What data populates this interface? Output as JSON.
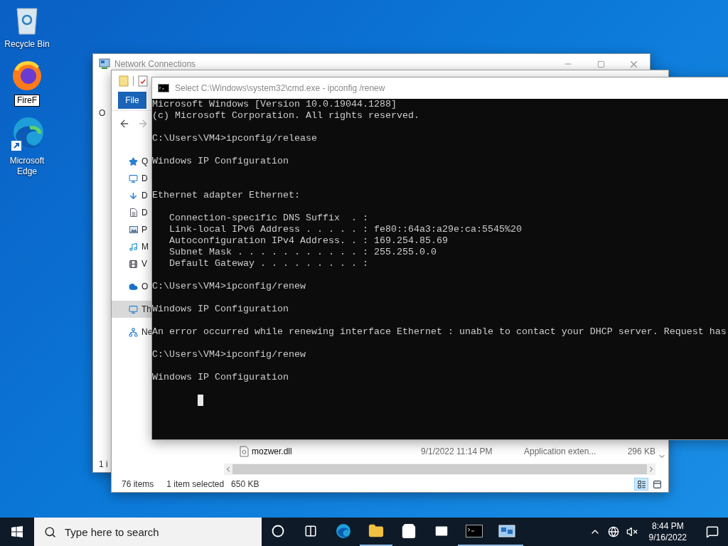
{
  "desktop_icons": [
    {
      "label": "Recycle Bin",
      "kind": "recycle",
      "renaming": false
    },
    {
      "label": "FireF",
      "kind": "firefox",
      "renaming": true
    },
    {
      "label": "Microsoft Edge",
      "kind": "edge",
      "renaming": false
    }
  ],
  "network_window": {
    "title": "Network Connections",
    "ribbon_fragment": "O",
    "status_fragment": "1 i"
  },
  "explorer": {
    "file_tab": "File",
    "sidebar": [
      {
        "label": "Q",
        "kind": "quick",
        "selected": false
      },
      {
        "label": "D",
        "kind": "desktop",
        "selected": false
      },
      {
        "label": "D",
        "kind": "downloads",
        "selected": false
      },
      {
        "label": "D",
        "kind": "documents",
        "selected": false
      },
      {
        "label": "P",
        "kind": "pictures",
        "selected": false
      },
      {
        "label": "M",
        "kind": "music",
        "selected": false
      },
      {
        "label": "V",
        "kind": "videos",
        "selected": false
      },
      {
        "label": "O",
        "kind": "onedrive",
        "selected": false
      },
      {
        "label": "Th",
        "kind": "pc",
        "selected": true
      },
      {
        "label": "Ne",
        "kind": "network",
        "selected": false
      }
    ],
    "files": [
      {
        "name": "mozwer.dll",
        "date": "9/1/2022 11:14 PM",
        "type": "Application exten...",
        "size": "296 KB"
      }
    ],
    "status": {
      "count": "76 items",
      "selection": "1 item selected",
      "size": "650 KB"
    },
    "views": [
      {
        "kind": "details",
        "selected": true
      },
      {
        "kind": "tiles",
        "selected": false
      }
    ]
  },
  "console": {
    "title": "Select C:\\Windows\\system32\\cmd.exe - ipconfig /renew",
    "cursor": true,
    "blocks": [
      {
        "kind": "text",
        "lines": [
          "Microsoft Windows [Version 10.0.19044.1288]",
          "(c) Microsoft Corporation. All rights reserved."
        ]
      },
      {
        "kind": "text",
        "lines": [
          "C:\\Users\\VM4>ipconfig/release"
        ]
      },
      {
        "kind": "text",
        "lines": [
          "Windows IP Configuration"
        ]
      },
      {
        "kind": "section",
        "lines": [
          "Ethernet adapter Ethernet:"
        ]
      },
      {
        "kind": "text",
        "lines": [
          "   Connection-specific DNS Suffix  . :",
          "   Link-local IPv6 Address . . . . . : fe80::64a3:a29e:ca:5545%20",
          "   Autoconfiguration IPv4 Address. . : 169.254.85.69",
          "   Subnet Mask . . . . . . . . . . . : 255.255.0.0",
          "   Default Gateway . . . . . . . . . :"
        ]
      },
      {
        "kind": "text",
        "lines": [
          "C:\\Users\\VM4>ipconfig/renew"
        ]
      },
      {
        "kind": "text",
        "lines": [
          "Windows IP Configuration"
        ]
      },
      {
        "kind": "text",
        "lines": [
          "An error occurred while renewing interface Ethernet : unable to contact your DHCP server. Request has"
        ]
      },
      {
        "kind": "text",
        "lines": [
          "C:\\Users\\VM4>ipconfig/renew"
        ]
      },
      {
        "kind": "text",
        "lines": [
          "Windows IP Configuration"
        ]
      }
    ]
  },
  "taskbar": {
    "search_placeholder": "Type here to search",
    "apps": [
      {
        "kind": "cortana",
        "running": false
      },
      {
        "kind": "taskview",
        "running": false
      },
      {
        "kind": "edge",
        "running": false
      },
      {
        "kind": "explorer",
        "running": true
      },
      {
        "kind": "store",
        "running": false
      },
      {
        "kind": "mail",
        "running": false
      },
      {
        "kind": "cmd",
        "running": true
      },
      {
        "kind": "netconn",
        "running": true
      }
    ],
    "time": "8:44 PM",
    "date": "9/16/2022"
  }
}
